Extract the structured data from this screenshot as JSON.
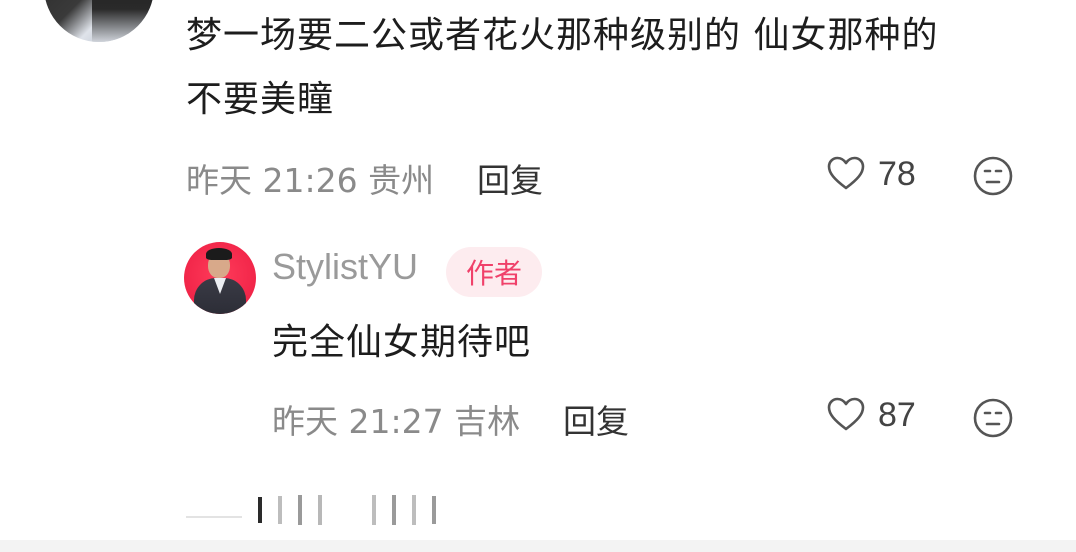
{
  "comment_1": {
    "text_line_1": "梦一场要二公或者花火那种级别的 仙女那种的",
    "text_line_2": "不要美瞳",
    "meta": "昨天 21:26 贵州",
    "reply_label": "回复",
    "like_count": "78",
    "icons": {
      "avatar": "user-avatar",
      "like": "heart-outline-icon",
      "dislike": "unhappy-face-icon"
    }
  },
  "reply_1": {
    "username": "StylistYU",
    "badge": "作者",
    "text": "完全仙女期待吧",
    "meta": "昨天 21:27 吉林",
    "reply_label": "回复",
    "like_count": "87",
    "icons": {
      "avatar": "author-avatar",
      "like": "heart-outline-icon",
      "dislike": "unhappy-face-icon"
    }
  },
  "colors": {
    "badge_text": "#f0416a",
    "badge_bg": "#fdecef",
    "meta_text": "#8a8a8a",
    "author_avatar_bg": "#f3284b"
  }
}
